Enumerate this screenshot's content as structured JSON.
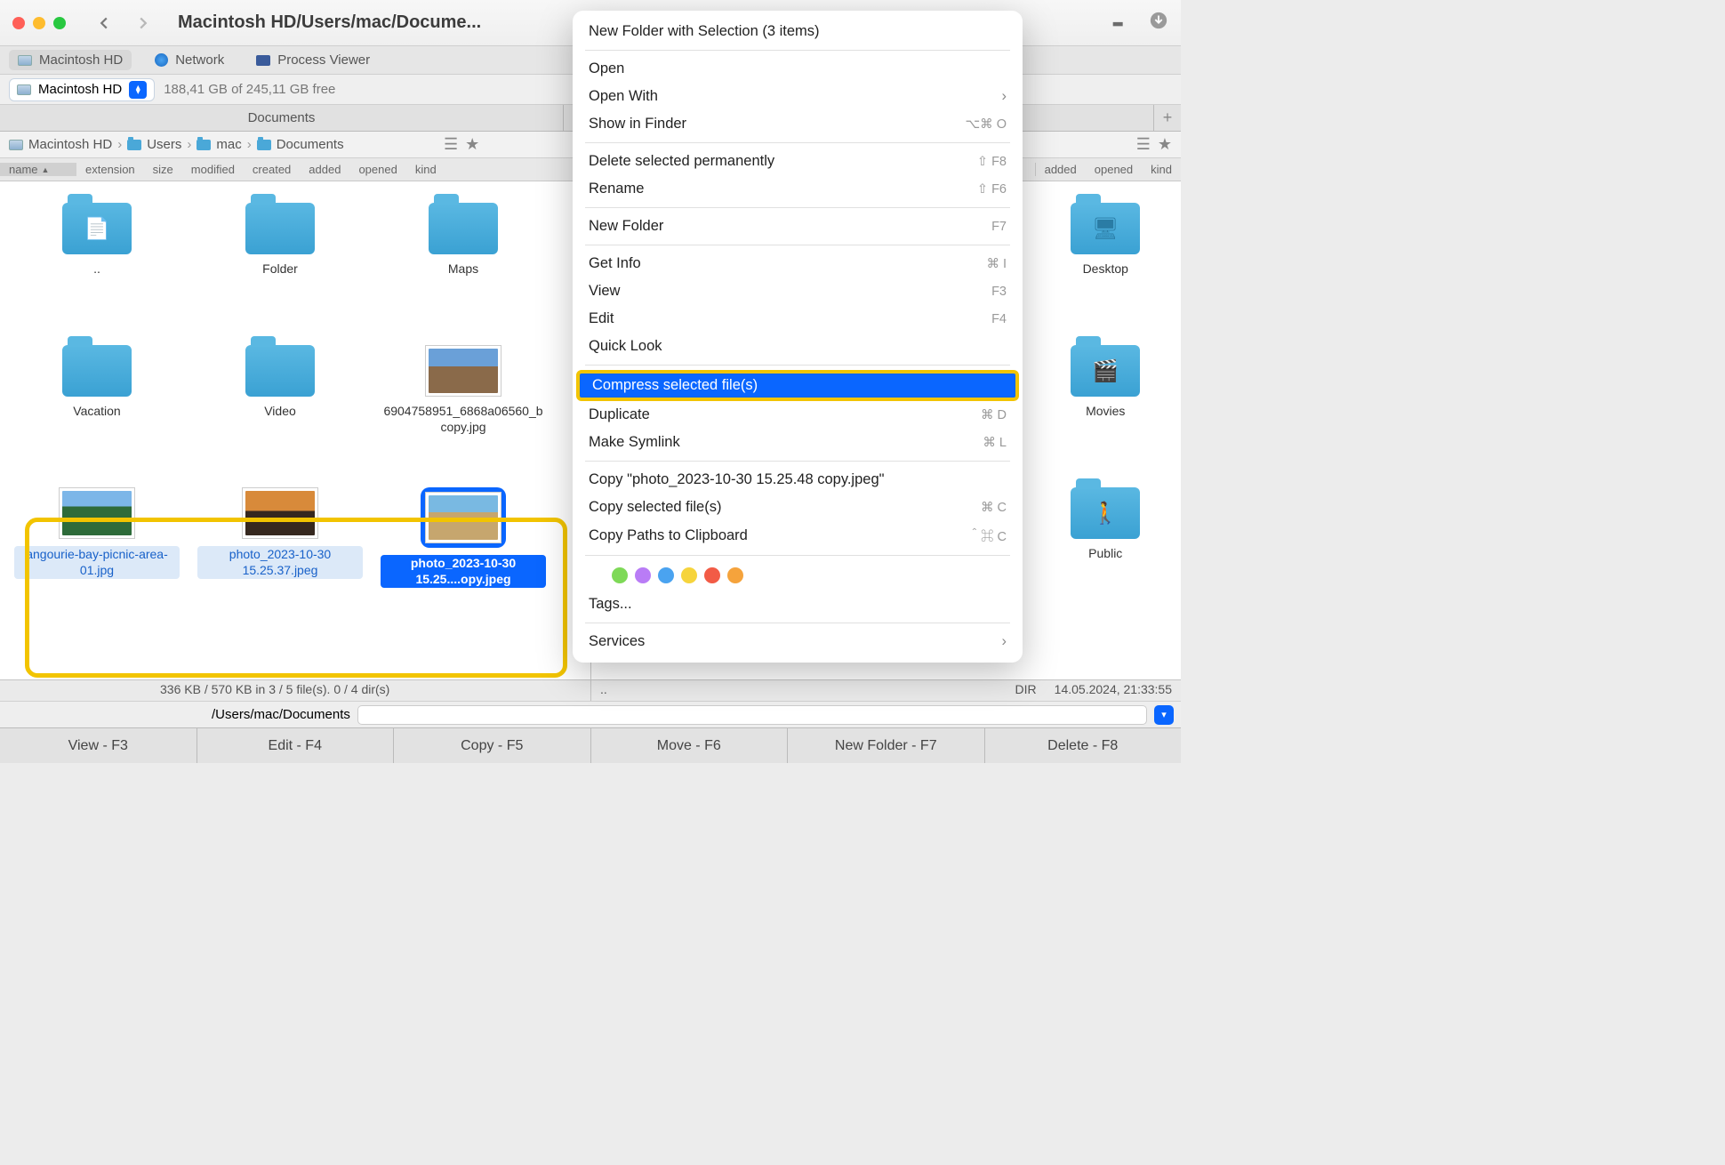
{
  "titlebar": {
    "path": "Macintosh HD/Users/mac/Docume..."
  },
  "tabs": {
    "t0": "Macintosh HD",
    "t1": "Network",
    "t2": "Process Viewer"
  },
  "volume": {
    "name": "Macintosh HD",
    "free": "188,41 GB of 245,11 GB free"
  },
  "paneTabs": {
    "left": "Documents",
    "right": "~"
  },
  "crumbs": {
    "c0": "Macintosh HD",
    "c1": "Users",
    "c2": "mac",
    "c3": "Documents"
  },
  "cols": {
    "name": "name",
    "ext": "extension",
    "size": "size",
    "mod": "modified",
    "created": "created",
    "added": "added",
    "opened": "opened",
    "kind": "kind",
    "r_added": "added",
    "r_opened": "opened",
    "r_kind": "kind"
  },
  "left_items": {
    "i0": "..",
    "i1": "Folder",
    "i2": "Maps",
    "i3": "Vacation",
    "i4": "Video",
    "i5": "6904758951_6868a06560_b copy.jpg",
    "i6": "angourie-bay-picnic-area-01.jpg",
    "i7": "photo_2023-10-30 15.25.37.jpeg",
    "i8": "photo_2023-10-30 15.25....opy.jpeg"
  },
  "right_items": {
    "i0": "Desktop",
    "i1": "Movies",
    "i2": "Public"
  },
  "status": {
    "left": "336 KB / 570 KB in 3 / 5 file(s). 0 / 4 dir(s)",
    "right_up": "..",
    "right_dir": "DIR",
    "right_date": "14.05.2024, 21:33:55"
  },
  "pathbar": {
    "path": "/Users/mac/Documents"
  },
  "fn": {
    "f3": "View - F3",
    "f4": "Edit - F4",
    "f5": "Copy - F5",
    "f6": "Move - F6",
    "f7": "New Folder - F7",
    "f8": "Delete - F8"
  },
  "menu": {
    "m0": "New Folder with Selection (3 items)",
    "m1": "Open",
    "m2": "Open With",
    "m3": "Show in Finder",
    "m4": "Delete selected permanently",
    "m4s": "⇧ F8",
    "m5": "Rename",
    "m5s": "⇧ F6",
    "m6": "New Folder",
    "m6s": "F7",
    "m7": "Get Info",
    "m7s": "⌘ I",
    "m8": "View",
    "m8s": "F3",
    "m9": "Edit",
    "m9s": "F4",
    "m10": "Quick Look",
    "m11": "Compress selected file(s)",
    "m12": "Duplicate",
    "m12s": "⌘ D",
    "m13": "Make Symlink",
    "m13s": "⌘ L",
    "m14": "Copy \"photo_2023-10-30 15.25.48 copy.jpeg\"",
    "m15": "Copy selected file(s)",
    "m15s": "⌘ C",
    "m16": "Copy Paths to Clipboard",
    "m16s": "＾⌘ C",
    "m17": "Tags...",
    "m18": "Services",
    "m3s": "⌥⌘ O"
  },
  "tag_colors": {
    "c0": "#bdbdbd",
    "c1": "#7ed957",
    "c2": "#b97cf6",
    "c3": "#4aa3f0",
    "c4": "#f6d43c",
    "c5": "#f25b46",
    "c6": "#f5a33c"
  }
}
